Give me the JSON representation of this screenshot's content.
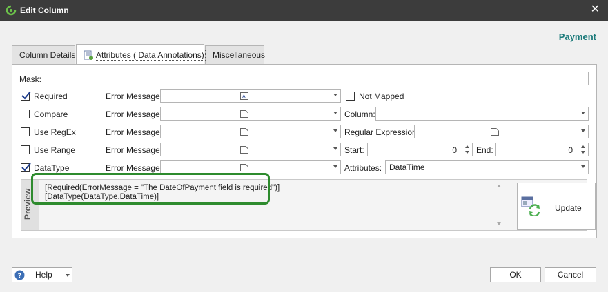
{
  "window": {
    "title": "Edit Column",
    "close_glyph": "✕"
  },
  "entity_name": "Payment",
  "tabs": [
    {
      "label": "Column Details",
      "active": false
    },
    {
      "label": "Attributes ( Data Annotations)",
      "active": true
    },
    {
      "label": "Miscellaneous",
      "active": false
    }
  ],
  "mask": {
    "label": "Mask:",
    "value": ""
  },
  "rows": {
    "required": {
      "label": "Required",
      "checked": true,
      "error_label": "Error Message:",
      "error_value": ""
    },
    "compare": {
      "label": "Compare",
      "checked": false,
      "error_label": "Error Message:",
      "error_value": "",
      "extra_label": "Column:",
      "extra_value": ""
    },
    "regex": {
      "label": "Use RegEx",
      "checked": false,
      "error_label": "Error Message:",
      "error_value": "",
      "extra_label": "Regular Expression:",
      "extra_value": ""
    },
    "range": {
      "label": "Use Range",
      "checked": false,
      "error_label": "Error Message:",
      "error_value": "",
      "start_label": "Start:",
      "start_value": "0",
      "end_label": "End:",
      "end_value": "0"
    },
    "datatype": {
      "label": "DataType",
      "checked": true,
      "error_label": "Error Message:",
      "error_value": "",
      "extra_label": "Attributes:",
      "extra_value": "DataTime"
    }
  },
  "not_mapped": {
    "label": "Not Mapped",
    "checked": false
  },
  "preview": {
    "tab_label": "Preview",
    "lines": [
      "[Required(ErrorMessage = \"The DateOfPayment field is required\")]",
      "[DataType(DataType.DataTime)]"
    ],
    "update_label": "Update"
  },
  "buttons": {
    "help": "Help",
    "ok": "OK",
    "cancel": "Cancel"
  },
  "colors": {
    "title_bar": "#3c3c3c",
    "accent": "#1b7a7a",
    "highlight": "#2e8b2e"
  }
}
